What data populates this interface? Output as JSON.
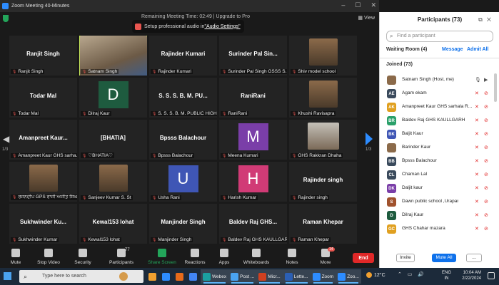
{
  "window": {
    "title": "Zoom Meeting 40-Minutes",
    "view_label": "View",
    "remaining": "Remaining Meeting Time: 02:49 | Upgrade to Pro",
    "notice_text": "Setup professional audio in ",
    "notice_link": "\"Audio Settings\""
  },
  "tiles": [
    {
      "name": "Ranjit Singh",
      "label": "Ranjit Singh",
      "kind": "name"
    },
    {
      "name": "",
      "label": "Satnam Singh",
      "kind": "video",
      "active": true
    },
    {
      "name": "Rajinder Kumari",
      "label": "Rajinder Kumari",
      "kind": "name"
    },
    {
      "name": "Surinder Pal Sin...",
      "label": "Surinder Pal Singh GSSS S...",
      "kind": "name"
    },
    {
      "name": "",
      "label": "Shiv model school",
      "kind": "photo"
    },
    {
      "name": "Todar Mal",
      "label": "Todar Mal",
      "kind": "name"
    },
    {
      "name": "D",
      "label": "Dilraj Kaur",
      "kind": "avatar",
      "color": "#1e5b3f"
    },
    {
      "name": "S. S. S. B. M. PU...",
      "label": "S. S. S. B. M. PUBLIC HIGH ...",
      "kind": "name"
    },
    {
      "name": "RaniRani",
      "label": "RaniRani",
      "kind": "name"
    },
    {
      "name": "",
      "label": "Khushi Ravisapra",
      "kind": "photo"
    },
    {
      "name": "Amanpreet Kaur...",
      "label": "Amanpreet Kaur GHS sarha...",
      "kind": "name"
    },
    {
      "name": "[BHATIA]",
      "label": "♡BHATIA♡",
      "kind": "name"
    },
    {
      "name": "Bpsss Balachour",
      "label": "Bpsss Balachour",
      "kind": "name"
    },
    {
      "name": "M",
      "label": "Meena Kumari",
      "kind": "avatar",
      "color": "#7a3ea8"
    },
    {
      "name": "",
      "label": "GHS Rakkran Dhaha",
      "kind": "photo"
    },
    {
      "name": "",
      "label": "ਰਜਨਦੀਪ GPS ਰਾਜੀ ਅਜੀਤ ਸਿੰਘ",
      "kind": "photo"
    },
    {
      "name": "",
      "label": "Sanjeev Kumar S. St",
      "kind": "photo"
    },
    {
      "name": "U",
      "label": "Usha Rani",
      "kind": "avatar",
      "color": "#3f56b5"
    },
    {
      "name": "H",
      "label": "Harish Kumar",
      "kind": "avatar",
      "color": "#d13b76"
    },
    {
      "name": "Rajinder singh",
      "label": "Rajinder singh",
      "kind": "name"
    },
    {
      "name": "Sukhwinder Ku...",
      "label": "Sukhwinder Kumar",
      "kind": "name"
    },
    {
      "name": "Kewal153 lohat",
      "label": "Kewal153 lohat",
      "kind": "name"
    },
    {
      "name": "Manjinder Singh",
      "label": "Manjinder Singh",
      "kind": "name"
    },
    {
      "name": "Baldev Raj GHS...",
      "label": "Baldev Raj GHS KAULLGARH",
      "kind": "name"
    },
    {
      "name": "Raman Khepar",
      "label": "Raman Khepar",
      "kind": "name"
    }
  ],
  "pager": {
    "left": "1/3",
    "right": "1/3"
  },
  "toolbar": {
    "mute": "Mute",
    "stop_video": "Stop Video",
    "security": "Security",
    "participants": "Participants",
    "participants_count": "77",
    "share_screen": "Share Screen",
    "reactions": "Reactions",
    "apps": "Apps",
    "whiteboards": "Whiteboards",
    "notes": "Notes",
    "more": "More",
    "more_badge": "14",
    "end": "End"
  },
  "panel": {
    "title": "Participants (73)",
    "search_placeholder": "Find a participant",
    "waiting_room": "Waiting Room (4)",
    "message": "Message",
    "admit_all": "Admit All",
    "joined": "Joined (73)",
    "invite": "Invite",
    "mute_all": "Mute All",
    "more": "..."
  },
  "participants": [
    {
      "initials": "",
      "name": "Satnam Singh (Host, me)",
      "color": "#8b6a4a",
      "host": true
    },
    {
      "initials": "AE",
      "name": "Agam ekam",
      "color": "#3a4a5c"
    },
    {
      "initials": "AK",
      "name": "Amanpreet Kaur GHS sarhala R...",
      "color": "#e0a020"
    },
    {
      "initials": "BR",
      "name": "Baldev Raj GHS KAULLGARH",
      "color": "#2aa06a"
    },
    {
      "initials": "BK",
      "name": "Baljit Kaur",
      "color": "#3f56b5"
    },
    {
      "initials": "",
      "name": "Barinder Kaur",
      "color": "#8b6a4a"
    },
    {
      "initials": "BB",
      "name": "Bpsss Balachour",
      "color": "#3a4a5c"
    },
    {
      "initials": "CL",
      "name": "Chaman Lal",
      "color": "#3a4a5c"
    },
    {
      "initials": "DK",
      "name": "Daljit kaur",
      "color": "#7a3ea8"
    },
    {
      "initials": "S",
      "name": "Dawn public school ,Urapar",
      "color": "#a0522d"
    },
    {
      "initials": "D",
      "name": "Dilraj Kaur",
      "color": "#1e5b3f"
    },
    {
      "initials": "GC",
      "name": "GHS Chahar mazara",
      "color": "#e0a020"
    }
  ],
  "taskbar": {
    "search_text": "Type here to search",
    "apps": [
      {
        "label": "",
        "color": "#f0a030"
      },
      {
        "label": "",
        "color": "#2d8cff"
      },
      {
        "label": "",
        "color": "#e66a1a"
      },
      {
        "label": "",
        "color": "#4285f4"
      },
      {
        "label": "Webex",
        "color": "#1ba0a0",
        "on": true
      },
      {
        "label": "Post ...",
        "color": "#4aa3f0",
        "on": true
      },
      {
        "label": "Micr...",
        "color": "#d04020",
        "on": true
      },
      {
        "label": "Lette...",
        "color": "#2b5fb4",
        "on": true
      },
      {
        "label": "Zoom",
        "color": "#2d8cff",
        "on": true
      },
      {
        "label": "Zoo...",
        "color": "#2d8cff",
        "on": true
      }
    ],
    "weather": "12°C",
    "lang1": "ENG",
    "lang2": "IN",
    "time": "10:04 AM",
    "date": "2/22/2024"
  }
}
